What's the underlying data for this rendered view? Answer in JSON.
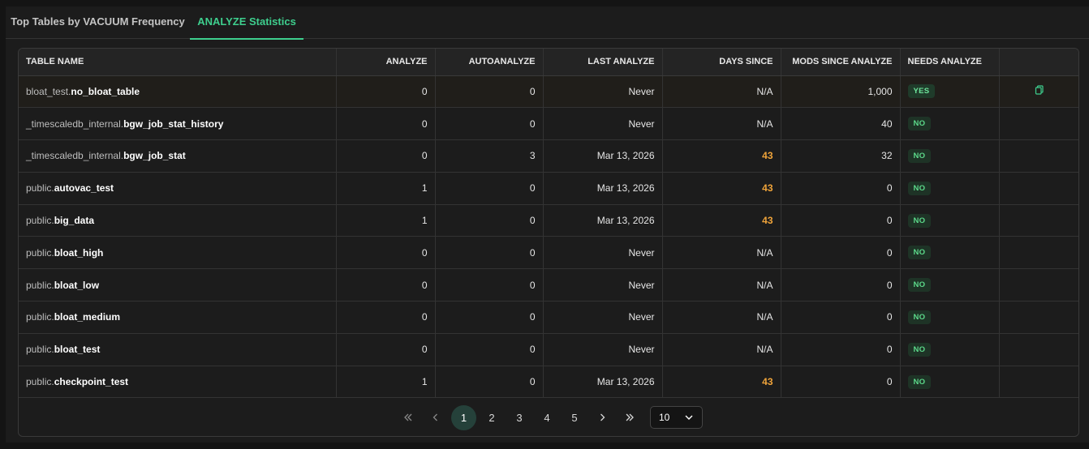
{
  "tabs": [
    {
      "label": "Top Tables by VACUUM Frequency"
    },
    {
      "label": "ANALYZE Statistics"
    }
  ],
  "columns": [
    "TABLE NAME",
    "ANALYZE",
    "AUTOANALYZE",
    "LAST ANALYZE",
    "DAYS SINCE",
    "MODS SINCE ANALYZE",
    "NEEDS ANALYZE",
    ""
  ],
  "rows": [
    {
      "schema": "bloat_test.",
      "table": "no_bloat_table",
      "analyze": "0",
      "autoanalyze": "0",
      "last": "Never",
      "days": "N/A",
      "mods": "1,000",
      "needs": "YES"
    },
    {
      "schema": "_timescaledb_internal.",
      "table": "bgw_job_stat_history",
      "analyze": "0",
      "autoanalyze": "0",
      "last": "Never",
      "days": "N/A",
      "mods": "40",
      "needs": "NO"
    },
    {
      "schema": "_timescaledb_internal.",
      "table": "bgw_job_stat",
      "analyze": "0",
      "autoanalyze": "3",
      "last": "Mar 13, 2026",
      "days": "43",
      "mods": "32",
      "needs": "NO"
    },
    {
      "schema": "public.",
      "table": "autovac_test",
      "analyze": "1",
      "autoanalyze": "0",
      "last": "Mar 13, 2026",
      "days": "43",
      "mods": "0",
      "needs": "NO"
    },
    {
      "schema": "public.",
      "table": "big_data",
      "analyze": "1",
      "autoanalyze": "0",
      "last": "Mar 13, 2026",
      "days": "43",
      "mods": "0",
      "needs": "NO"
    },
    {
      "schema": "public.",
      "table": "bloat_high",
      "analyze": "0",
      "autoanalyze": "0",
      "last": "Never",
      "days": "N/A",
      "mods": "0",
      "needs": "NO"
    },
    {
      "schema": "public.",
      "table": "bloat_low",
      "analyze": "0",
      "autoanalyze": "0",
      "last": "Never",
      "days": "N/A",
      "mods": "0",
      "needs": "NO"
    },
    {
      "schema": "public.",
      "table": "bloat_medium",
      "analyze": "0",
      "autoanalyze": "0",
      "last": "Never",
      "days": "N/A",
      "mods": "0",
      "needs": "NO"
    },
    {
      "schema": "public.",
      "table": "bloat_test",
      "analyze": "0",
      "autoanalyze": "0",
      "last": "Never",
      "days": "N/A",
      "mods": "0",
      "needs": "NO"
    },
    {
      "schema": "public.",
      "table": "checkpoint_test",
      "analyze": "1",
      "autoanalyze": "0",
      "last": "Mar 13, 2026",
      "days": "43",
      "mods": "0",
      "needs": "NO"
    }
  ],
  "pagination": {
    "first_icon": "double-chevron-left-icon",
    "prev_icon": "chevron-left-icon",
    "pages": [
      "1",
      "2",
      "3",
      "4",
      "5"
    ],
    "current": "1",
    "next_icon": "chevron-right-icon",
    "last_icon": "double-chevron-right-icon",
    "page_size": "10"
  },
  "colors": {
    "accent": "#3ecf8e",
    "warning": "#f0a43a",
    "badge_bg": "#1e3326"
  }
}
